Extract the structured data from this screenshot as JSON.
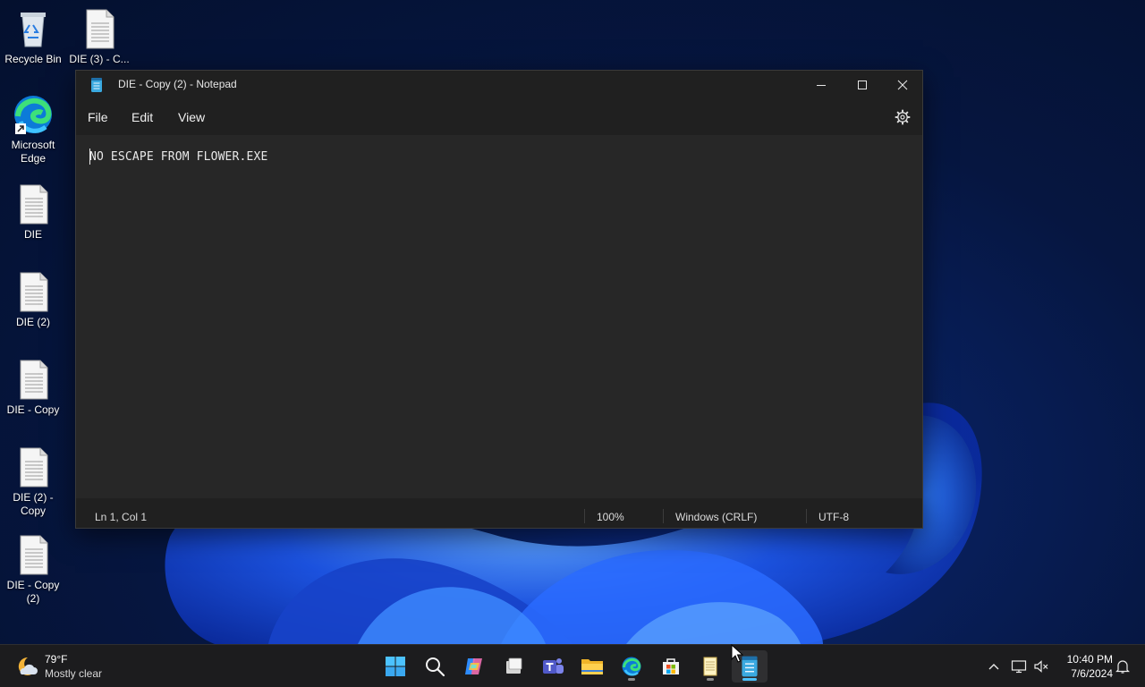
{
  "desktop": {
    "icons": [
      {
        "label": "Recycle Bin",
        "icon": "recycle-bin-icon"
      },
      {
        "label": "DIE (3) - C...",
        "icon": "text-file-icon"
      },
      {
        "label": "Microsoft Edge",
        "icon": "edge-icon"
      },
      {
        "label": "DIE",
        "icon": "text-file-icon"
      },
      {
        "label": "DIE (2)",
        "icon": "text-file-icon"
      },
      {
        "label": "DIE - Copy",
        "icon": "text-file-icon"
      },
      {
        "label": "DIE (2) - Copy",
        "icon": "text-file-icon"
      },
      {
        "label": "DIE - Copy (2)",
        "icon": "text-file-icon"
      }
    ]
  },
  "window": {
    "title": "DIE - Copy (2) - Notepad",
    "app_icon": "notepad-icon",
    "controls": [
      "minimize-icon",
      "maximize-icon",
      "close-icon"
    ],
    "menu": [
      "File",
      "Edit",
      "View"
    ],
    "settings_icon": "gear-icon",
    "content": "NO ESCAPE FROM FLOWER.EXE",
    "status": {
      "position": "Ln 1, Col 1",
      "zoom": "100%",
      "line_ending": "Windows (CRLF)",
      "encoding": "UTF-8"
    }
  },
  "taskbar": {
    "weather": {
      "temp": "79°F",
      "condition": "Mostly clear",
      "icon": "moon-cloud-icon"
    },
    "apps": [
      {
        "name": "start-icon"
      },
      {
        "name": "search-icon"
      },
      {
        "name": "copilot-icon"
      },
      {
        "name": "task-view-icon"
      },
      {
        "name": "teams-icon"
      },
      {
        "name": "file-explorer-icon"
      },
      {
        "name": "edge-icon"
      },
      {
        "name": "store-icon"
      },
      {
        "name": "notepad-classic-icon"
      },
      {
        "name": "notepad-icon"
      }
    ],
    "tray": [
      "chevron-up-icon",
      "network-icon",
      "volume-muted-icon",
      "notification-icon"
    ],
    "time": "10:40 PM",
    "date": "7/6/2024"
  },
  "colors": {
    "accent": "#4cc2ff",
    "window_bg": "#272727",
    "chrome_bg": "#202020",
    "taskbar_bg": "#1c1c1e"
  }
}
